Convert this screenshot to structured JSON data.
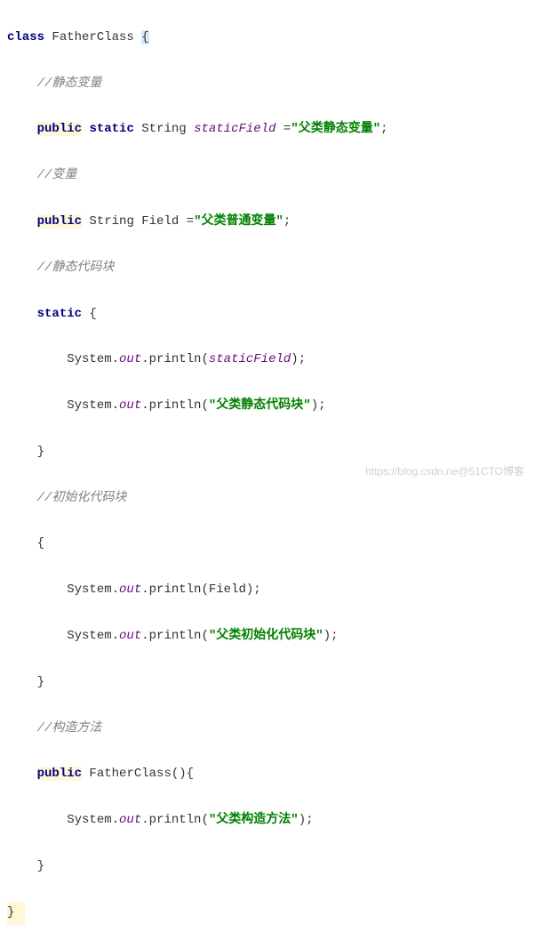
{
  "code": {
    "l1_kw_class": "class",
    "l1_classname": " FatherClass ",
    "l1_brace": "{",
    "l2_cmt": "//静态变量",
    "l3_public": "public",
    "l3_static": "static",
    "l3_type": " String ",
    "l3_field": "staticField",
    "l3_assign": " =",
    "l3_str": "\"父类静态变量\"",
    "l3_semi": ";",
    "l4_cmt": "//变量",
    "l5_public": "public",
    "l5_type": " String Field =",
    "l5_str": "\"父类普通变量\"",
    "l5_semi": ";",
    "l6_cmt": "//静态代码块",
    "l7_static": "static",
    "l7_brace": " {",
    "l8_pre": "System.",
    "l8_out": "out",
    "l8_mid": ".println(",
    "l8_arg": "staticField",
    "l8_end": ");",
    "l9_pre": "System.",
    "l9_out": "out",
    "l9_mid": ".println(",
    "l9_arg": "\"父类静态代码块\"",
    "l9_end": ");",
    "l10_brace": "}",
    "l11_cmt": "//初始化代码块",
    "l12_brace": "{",
    "l13_pre": "System.",
    "l13_out": "out",
    "l13_mid": ".println(Field);",
    "l14_pre": "System.",
    "l14_out": "out",
    "l14_mid": ".println(",
    "l14_arg": "\"父类初始化代码块\"",
    "l14_end": ");",
    "l15_brace": "}",
    "l16_cmt": "//构造方法",
    "l17_public": "public",
    "l17_rest": " FatherClass(){",
    "l18_pre": "System.",
    "l18_out": "out",
    "l18_mid": ".println(",
    "l18_arg": "\"父类构造方法\"",
    "l18_end": ");",
    "l19_brace": "}",
    "l20_brace": "}"
  },
  "watermark": "https://blog.csdn.ne@51CTO博客"
}
